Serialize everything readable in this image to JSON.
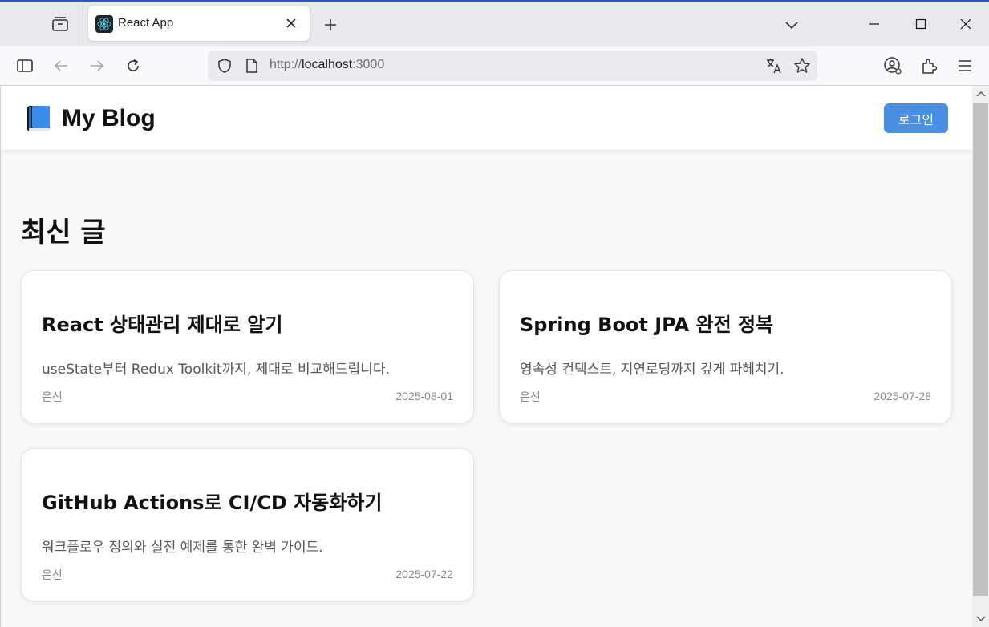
{
  "browser": {
    "tab_title": "React App",
    "url_scheme": "http://",
    "url_host": "localhost",
    "url_port": ":3000"
  },
  "site": {
    "logo_icon": "blue-book-icon",
    "title": "My Blog",
    "login_label": "로그인",
    "section_title": "최신 글"
  },
  "posts": [
    {
      "title": "React 상태관리 제대로 알기",
      "summary": "useState부터 Redux Toolkit까지, 제대로 비교해드립니다.",
      "author": "은선",
      "date": "2025-08-01"
    },
    {
      "title": "Spring Boot JPA 완전 정복",
      "summary": "영속성 컨텍스트, 지연로딩까지 깊게 파헤치기.",
      "author": "은선",
      "date": "2025-07-28"
    },
    {
      "title": "GitHub Actions로 CI/CD 자동화하기",
      "summary": "워크플로우 정의와 실전 예제를 통한 완벽 가이드.",
      "author": "은선",
      "date": "2025-07-22"
    }
  ],
  "colors": {
    "accent": "#4a90e2",
    "browser_accent": "#2c54c8"
  }
}
